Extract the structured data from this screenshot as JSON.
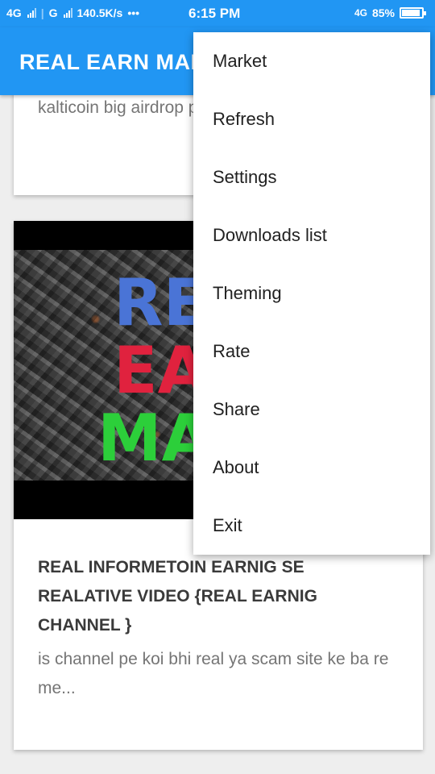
{
  "status_bar": {
    "sim1": "4G",
    "sim2": "G",
    "speed": "140.5K/s",
    "dots": "•••",
    "time": "6:15 PM",
    "network": "4G",
    "battery": "85%",
    "battery_level": 0.85
  },
  "appbar": {
    "title": "REAL EARN MARKET",
    "color": "#2196f3"
  },
  "feed": {
    "card1": {
      "description": "kalticoin big airdrop p ....."
    },
    "card2": {
      "thumbnail_words": [
        "REAL",
        "EARN",
        "MARKET"
      ],
      "title": "REAL INFORMETOIN EARNIG SE REALATIVE VIDEO {REAL EARNIG CHANNEL }",
      "description": "is channel pe koi bhi real ya scam site ke ba re me..."
    }
  },
  "menu": {
    "items": [
      "Market",
      "Refresh",
      "Settings",
      "Downloads list",
      "Theming",
      "Rate",
      "Share",
      "About",
      "Exit"
    ]
  }
}
